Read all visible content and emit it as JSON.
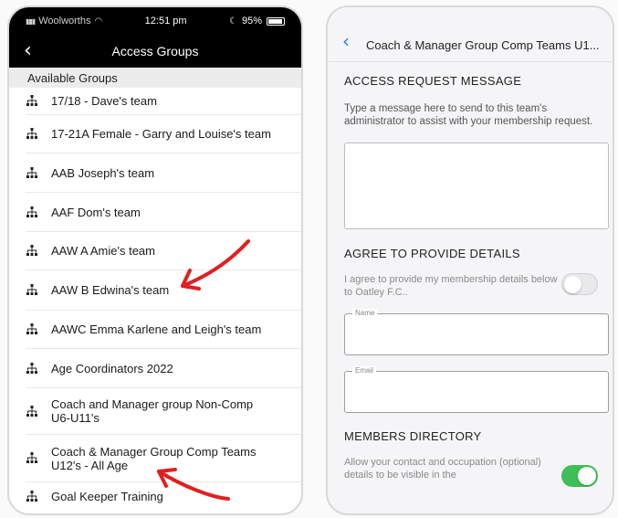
{
  "left": {
    "status": {
      "carrier": "Woolworths",
      "time": "12:51 pm",
      "battery": "95%"
    },
    "nav": {
      "title": "Access Groups",
      "back": "‹"
    },
    "section_header": "Available Groups",
    "groups": [
      {
        "label": "17/18 - Dave's team"
      },
      {
        "label": "17-21A Female - Garry and Louise's team"
      },
      {
        "label": "AAB Joseph's team"
      },
      {
        "label": "AAF Dom's team"
      },
      {
        "label": "AAW A Amie's team"
      },
      {
        "label": "AAW B Edwina's team"
      },
      {
        "label": "AAWC Emma Karlene and Leigh's team"
      },
      {
        "label": "Age Coordinators 2022"
      },
      {
        "label": "Coach and Manager group Non-Comp U6-U11's"
      },
      {
        "label": "Coach & Manager Group Comp Teams U12's - All Age"
      },
      {
        "label": "Goal Keeper Training"
      }
    ]
  },
  "right": {
    "nav": {
      "back": "‹",
      "title": "Coach & Manager Group Comp Teams U1..."
    },
    "access_heading": "ACCESS REQUEST MESSAGE",
    "access_desc": "Type a message here to send to this team's administrator to assist with your membership request.",
    "agree_heading": "AGREE TO PROVIDE DETAILS",
    "agree_text": "I agree to provide my membership details below to Oatley F.C..",
    "agree_toggle": "off",
    "name_label": "Name",
    "email_label": "Email",
    "members_heading": "MEMBERS DIRECTORY",
    "members_text": "Allow your contact and occupation (optional) details to be visible in the",
    "members_toggle": "on"
  },
  "colors": {
    "arrow": "#e02020",
    "accent": "#2f7fd8",
    "toggle_on": "#3fbf55"
  }
}
